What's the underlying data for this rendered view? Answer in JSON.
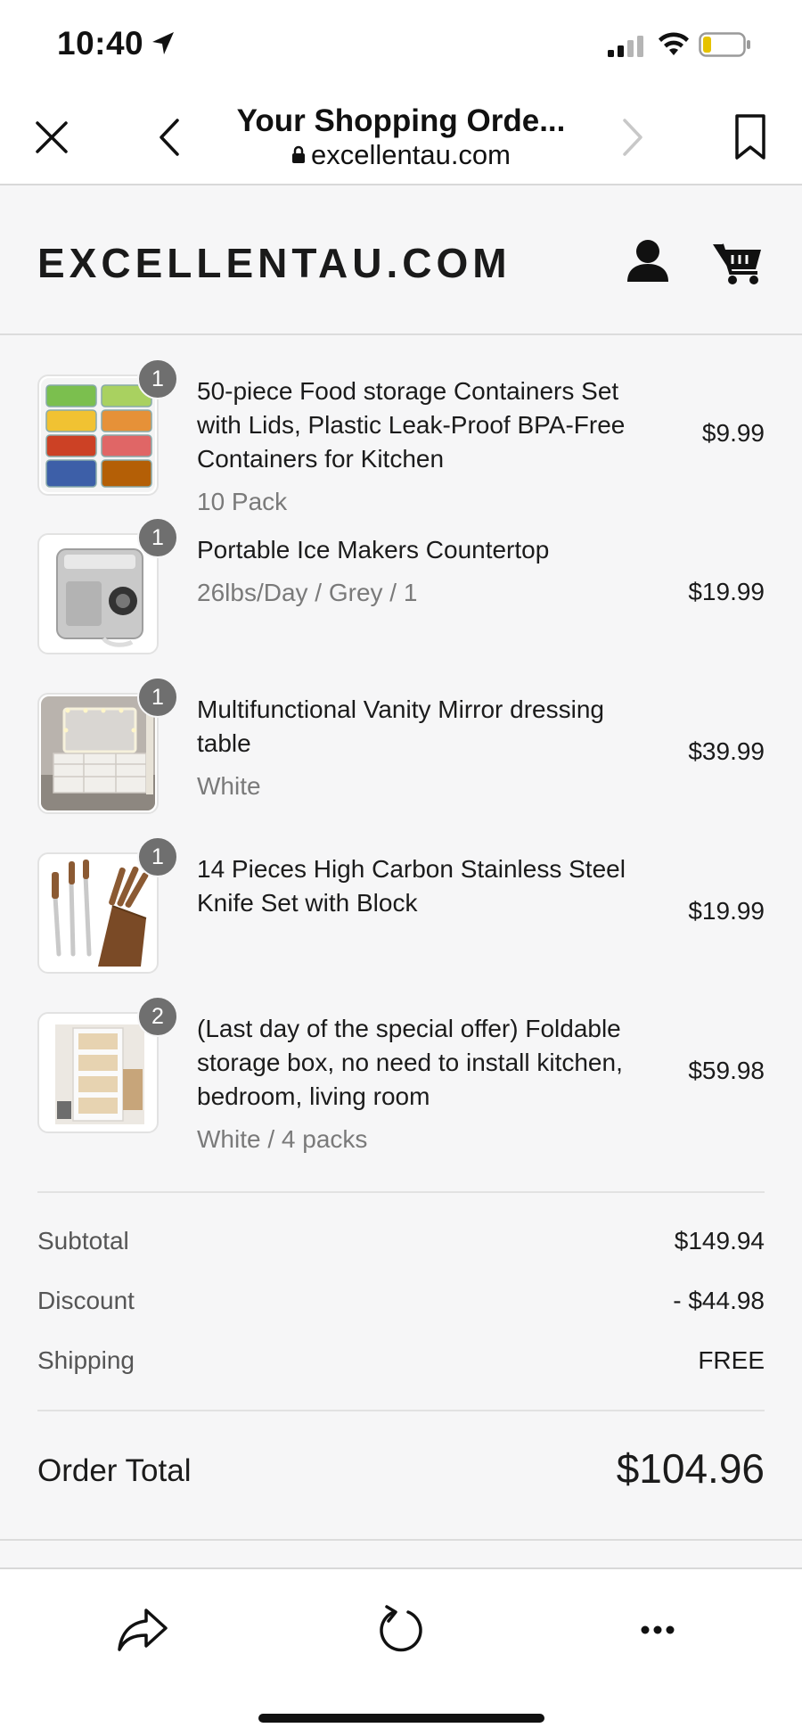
{
  "status_bar": {
    "time": "10:40",
    "location_icon": "location-arrow-icon",
    "signal_icon": "cellular-signal-icon",
    "wifi_icon": "wifi-icon",
    "battery_icon": "battery-low-icon"
  },
  "browser": {
    "title": "Your Shopping Orde...",
    "url": "excellentau.com",
    "close_icon": "close-icon",
    "back_icon": "chevron-left-icon",
    "forward_icon": "chevron-right-icon",
    "bookmark_icon": "bookmark-icon"
  },
  "store": {
    "logo": "EXCELLENTAU.COM",
    "account_icon": "user-icon",
    "cart_icon": "cart-icon"
  },
  "items": [
    {
      "qty": "1",
      "title": "50-piece Food storage Containers Set with Lids, Plastic Leak-Proof BPA-Free Containers for Kitchen",
      "variant": "10 Pack",
      "price": "$9.99"
    },
    {
      "qty": "1",
      "title": "Portable Ice Makers Countertop",
      "variant": "26lbs/Day / Grey / 1",
      "price": "$19.99"
    },
    {
      "qty": "1",
      "title": "Multifunctional Vanity Mirror dressing table",
      "variant": "White",
      "price": "$39.99"
    },
    {
      "qty": "1",
      "title": "14 Pieces High Carbon Stainless Steel Knife Set with Block",
      "variant": "",
      "price": "$19.99"
    },
    {
      "qty": "2",
      "title": "(Last day of the special offer) Foldable storage box, no need to install kitchen, bedroom, living room",
      "variant": "White / 4 packs",
      "price": "$59.98"
    }
  ],
  "summary": {
    "subtotal_label": "Subtotal",
    "subtotal_value": "$149.94",
    "discount_label": "Discount",
    "discount_value": "- $44.98",
    "shipping_label": "Shipping",
    "shipping_value": "FREE",
    "total_label": "Order Total",
    "total_value": "$104.96"
  },
  "toolbar": {
    "share_icon": "share-icon",
    "reload_icon": "reload-icon",
    "more_icon": "more-icon"
  },
  "colors": {
    "page_background": "#f6f6f7",
    "badge": "#6f6f6f",
    "muted_text": "#7a7a7a"
  }
}
